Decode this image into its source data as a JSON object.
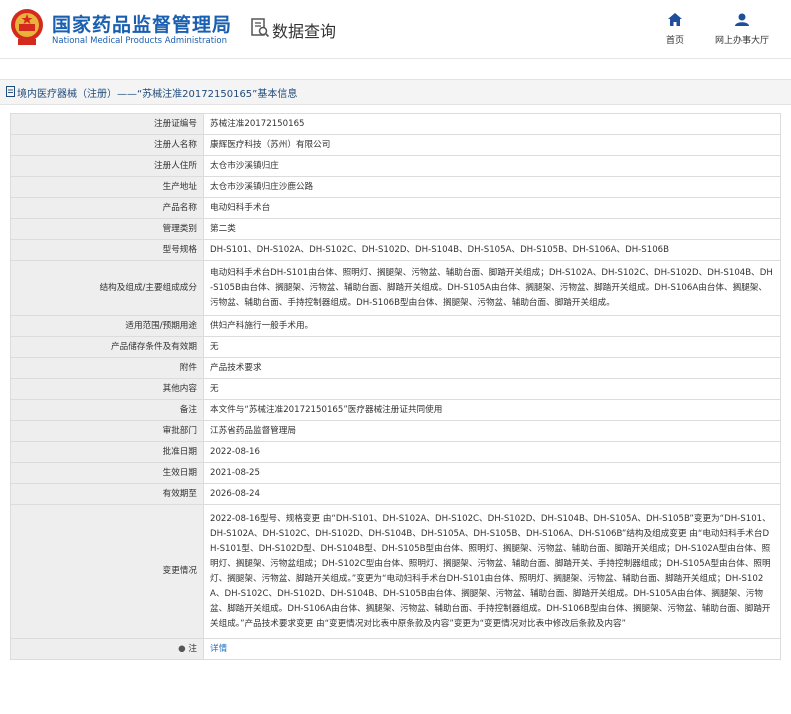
{
  "header": {
    "brand_cn": "国家药品监督管理局",
    "brand_en": "National Medical Products Administration",
    "query_title": "数据查询",
    "nav": {
      "home": "首页",
      "office": "网上办事大厅"
    }
  },
  "titlebar": {
    "text": "境内医疗器械（注册）——“苏械注准20172150165”基本信息"
  },
  "rows": [
    {
      "label": "注册证编号",
      "value": "苏械注准20172150165"
    },
    {
      "label": "注册人名称",
      "value": "康辉医疗科技（苏州）有限公司"
    },
    {
      "label": "注册人住所",
      "value": "太仓市沙溪镇归庄"
    },
    {
      "label": "生产地址",
      "value": "太仓市沙溪镇归庄沙鹿公路"
    },
    {
      "label": "产品名称",
      "value": "电动妇科手术台"
    },
    {
      "label": "管理类别",
      "value": "第二类"
    },
    {
      "label": "型号规格",
      "value": "DH-S101、DH-S102A、DH-S102C、DH-S102D、DH-S104B、DH-S105A、DH-S105B、DH-S106A、DH-S106B"
    },
    {
      "label": "结构及组成/主要组成成分",
      "value": "电动妇科手术台DH-S101由台体、照明灯、搁腿架、污物盆、辅助台面、脚踏开关组成；DH-S102A、DH-S102C、DH-S102D、DH-S104B、DH-S105B由台体、搁腿架、污物盆、辅助台面、脚踏开关组成。DH-S105A由台体、搁腿架、污物盆、脚踏开关组成。DH-S106A由台体、搁腿架、污物盆、辅助台面、手持控制器组成。DH-S106B型由台体、搁腿架、污物盆、辅助台面、脚踏开关组成。"
    },
    {
      "label": "适用范围/预期用途",
      "value": "供妇产科施行一般手术用。"
    },
    {
      "label": "产品储存条件及有效期",
      "value": "无"
    },
    {
      "label": "附件",
      "value": "产品技术要求"
    },
    {
      "label": "其他内容",
      "value": "无"
    },
    {
      "label": "备注",
      "value": "本文件与“苏械注准20172150165”医疗器械注册证共同使用"
    },
    {
      "label": "审批部门",
      "value": "江苏省药品监督管理局"
    },
    {
      "label": "批准日期",
      "value": "2022-08-16"
    },
    {
      "label": "生效日期",
      "value": "2021-08-25"
    },
    {
      "label": "有效期至",
      "value": "2026-08-24"
    },
    {
      "label": "变更情况",
      "value": "2022-08-16型号、规格变更 由“DH-S101、DH-S102A、DH-S102C、DH-S102D、DH-S104B、DH-S105A、DH-S105B”变更为“DH-S101、DH-S102A、DH-S102C、DH-S102D、DH-S104B、DH-S105A、DH-S105B、DH-S106A、DH-S106B”结构及组成变更 由“电动妇科手术台DH-S101型、DH-S102D型、DH-S104B型、DH-S105B型由台体、照明灯、搁腿架、污物盆、辅助台面、脚踏开关组成；DH-S102A型由台体、照明灯、搁腿架、污物盆组成；DH-S102C型由台体、照明灯、搁腿架、污物盆、辅助台面、脚踏开关、手持控制器组成；DH-S105A型由台体、照明灯、搁腿架、污物盆、脚踏开关组成。”变更为“电动妇科手术台DH-S101由台体、照明灯、搁腿架、污物盆、辅助台面、脚踏开关组成；DH-S102A、DH-S102C、DH-S102D、DH-S104B、DH-S105B由台体、搁腿架、污物盆、辅助台面、脚踏开关组成。DH-S105A由台体、搁腿架、污物盆、脚踏开关组成。DH-S106A由台体、搁腿架、污物盆、辅助台面、手持控制器组成。DH-S106B型由台体、搁腿架、污物盆、辅助台面、脚踏开关组成。”产品技术要求变更 由“变更情况对比表中原条款及内容”变更为“变更情况对比表中修改后条款及内容”"
    }
  ],
  "note_row": {
    "label": "注",
    "value": "详情"
  }
}
